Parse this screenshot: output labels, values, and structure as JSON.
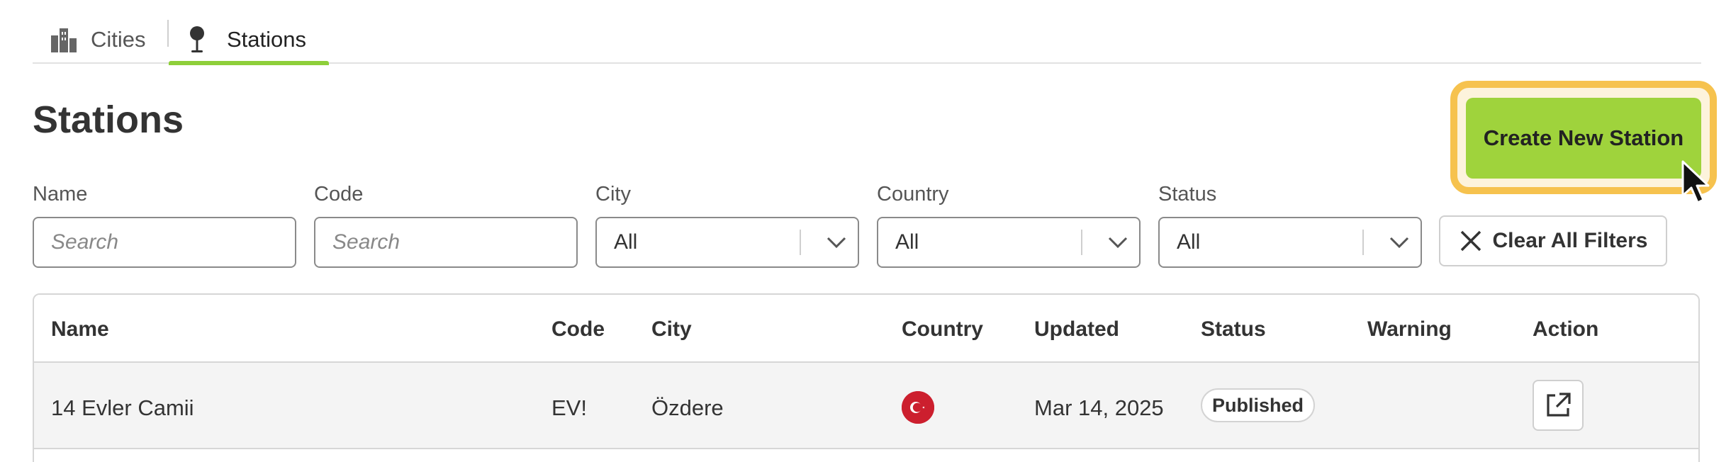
{
  "tabs": [
    {
      "label": "Cities",
      "icon": "city-buildings-icon",
      "active": false
    },
    {
      "label": "Stations",
      "icon": "station-pin-icon",
      "active": true
    }
  ],
  "page": {
    "title": "Stations",
    "create_button": "Create New Station"
  },
  "filters": {
    "name": {
      "label": "Name",
      "placeholder": "Search"
    },
    "code": {
      "label": "Code",
      "placeholder": "Search"
    },
    "city": {
      "label": "City",
      "value": "All"
    },
    "country": {
      "label": "Country",
      "value": "All"
    },
    "status": {
      "label": "Status",
      "value": "All"
    },
    "clear_button": "Clear All Filters"
  },
  "table": {
    "columns": [
      "Name",
      "Code",
      "City",
      "Country",
      "Updated",
      "Status",
      "Warning",
      "Action"
    ],
    "rows": [
      {
        "name": "14 Evler Camii",
        "code": "EV!",
        "city": "Özdere",
        "country_flag": "turkey-flag-icon",
        "updated": "Mar 14, 2025",
        "status": "Published",
        "warning": "",
        "action_icon": "open-external-icon"
      }
    ]
  },
  "colors": {
    "accent_green": "#9fd33c",
    "tab_underline": "#8ecf3a",
    "highlight": "#f6c24e",
    "flag_red": "#cc1f2e"
  }
}
